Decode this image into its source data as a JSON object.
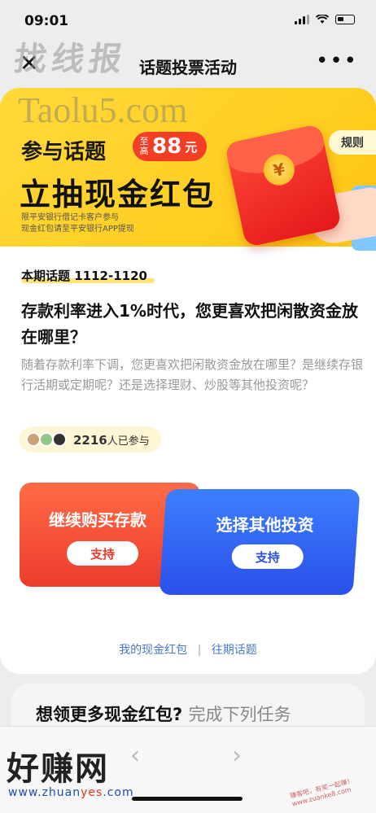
{
  "status": {
    "time": "09:01"
  },
  "nav": {
    "close": "✕",
    "title": "话题投票活动",
    "more": "•••"
  },
  "watermarks": {
    "top": "找线报",
    "url": "Taolu5.com",
    "bottom": "好赚网",
    "bottom_url_a": "www.zhuan",
    "bottom_url_b": "yes",
    "bottom_url_c": ".com",
    "side": "赚客吧，有奖一起赚！www.zuanke8.com"
  },
  "banner": {
    "line1": "参与话题",
    "pill_pre": "至高",
    "pill_num": "88",
    "pill_unit": "元",
    "line2": "立抽现金红包",
    "note1": "限平安银行借记卡客户参与",
    "note2": "现金红包请至平安银行APP提现",
    "rules": "规则",
    "coin": "¥"
  },
  "topic": {
    "tag": "本期话题 1112-1120",
    "question": "存款利率进入1%时代，您更喜欢把闲散资金放在哪里？",
    "desc": "随着存款利率下调，您更喜欢把闲散资金放在哪里？是继续存银行活期或定期呢？还是选择理财、炒股等其他投资呢？",
    "count": "2216",
    "count_suffix": "人已参与"
  },
  "options": [
    {
      "label": "继续购买存款",
      "button": "支持",
      "color": "#ec3b2d"
    },
    {
      "label": "选择其他投资",
      "button": "支持",
      "color": "#2a50e9"
    }
  ],
  "links": {
    "my_packets": "我的现金红包",
    "separator": "|",
    "past_topics": "往期话题"
  },
  "task": {
    "title": "想领更多现金红包?",
    "subtitle": "完成下列任务"
  },
  "bottom_nav": {
    "back": "‹",
    "forward": "›"
  }
}
